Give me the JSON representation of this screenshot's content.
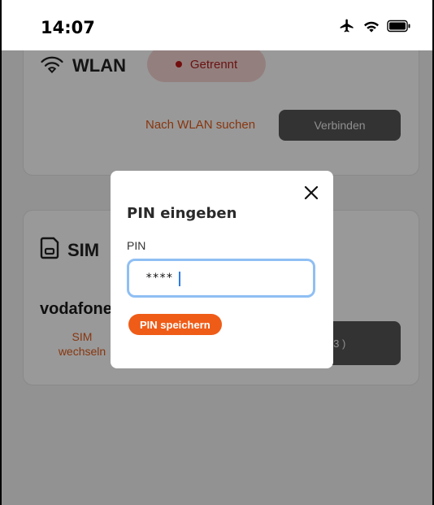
{
  "status_bar": {
    "time": "14:07",
    "icons": [
      "airplane-icon",
      "wifi-icon",
      "battery-icon"
    ]
  },
  "wlan_card": {
    "title": "WLAN",
    "icon": "wifi-icon",
    "status": "Getrennt",
    "search_label": "Nach WLAN suchen",
    "connect_label": "Verbinden"
  },
  "sim_card": {
    "title": "SIM",
    "icon": "sim-card-icon",
    "provider": "vodafone",
    "change_label": "SIM wechseln",
    "right_button_label": "t (3 )"
  },
  "modal": {
    "title": "PIN eingeben",
    "field_label": "PIN",
    "pin_value": "****",
    "save_label": "PIN speichern",
    "close_icon": "close-icon"
  },
  "colors": {
    "accent": "#ef5c17",
    "status_error": "#c01818",
    "input_focus": "#8fbff3",
    "button_dark": "#555555"
  }
}
